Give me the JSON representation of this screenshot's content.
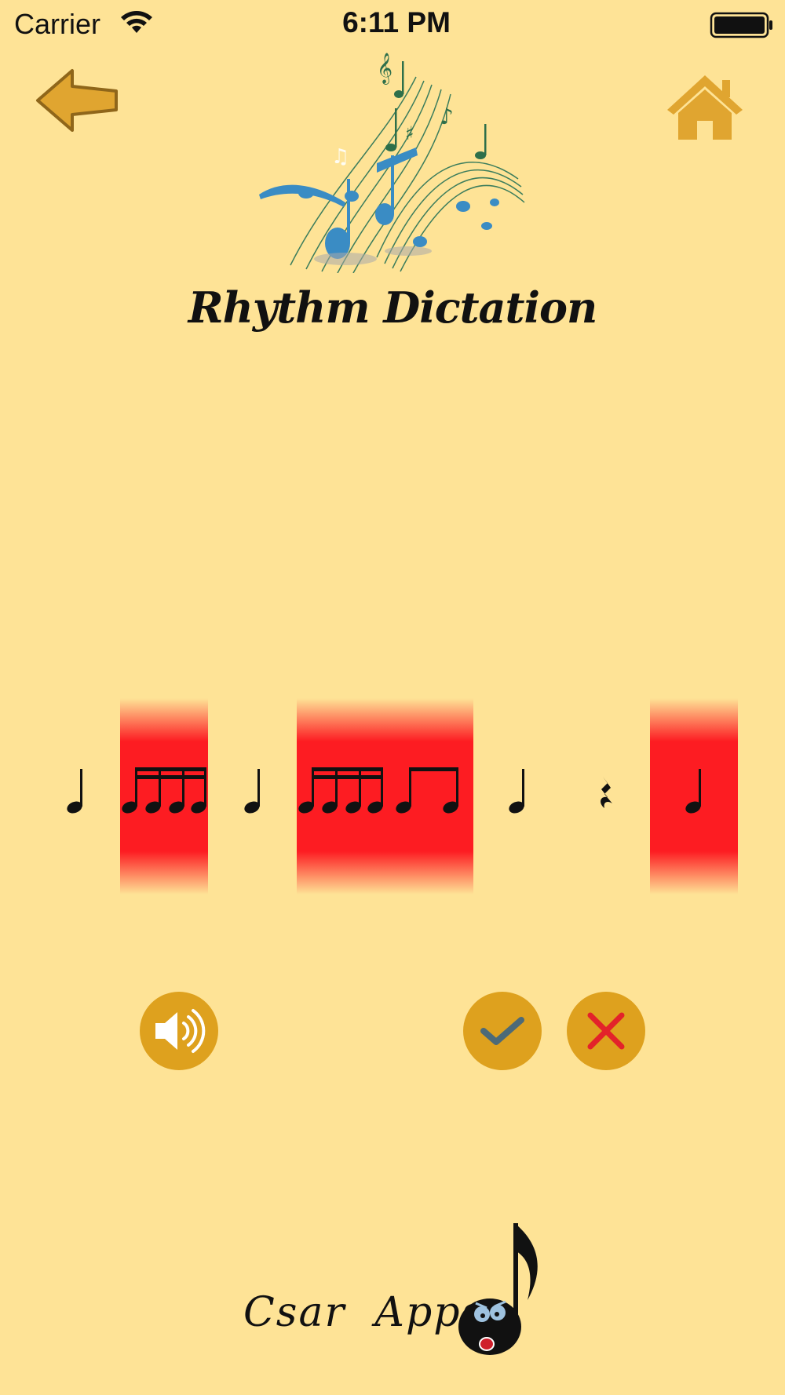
{
  "status_bar": {
    "carrier": "Carrier",
    "time": "6:11 PM",
    "wifi_icon": "wifi-icon",
    "battery_icon": "battery-full-icon"
  },
  "nav": {
    "back_icon": "arrow-left-icon",
    "home_icon": "home-icon"
  },
  "header": {
    "logo_icon": "music-notes-swirl-icon",
    "title": "Rhythm Dictation"
  },
  "rhythm": {
    "beats": [
      {
        "symbol": "quarter-note",
        "highlighted": false
      },
      {
        "symbol": "four-sixteenth-notes",
        "highlighted": true
      },
      {
        "symbol": "quarter-note",
        "highlighted": false
      },
      {
        "symbol": "four-sixteenth-notes",
        "highlighted": true
      },
      {
        "symbol": "two-eighth-notes",
        "highlighted": true
      },
      {
        "symbol": "quarter-note",
        "highlighted": false
      },
      {
        "symbol": "quarter-rest",
        "highlighted": false
      },
      {
        "symbol": "quarter-note",
        "highlighted": true
      }
    ],
    "highlight_color": "#fd1c22"
  },
  "controls": {
    "audio_icon": "speaker-icon",
    "check_icon": "checkmark-icon",
    "cancel_icon": "x-icon",
    "button_color": "#dea11e",
    "check_color": "#4c6a78",
    "cancel_color": "#e3222a"
  },
  "footer": {
    "brand": "Csar  Apps",
    "mascot_icon": "singing-eighth-note-mascot-icon"
  },
  "theme": {
    "background": "#fee396",
    "accent": "#e0a530"
  }
}
